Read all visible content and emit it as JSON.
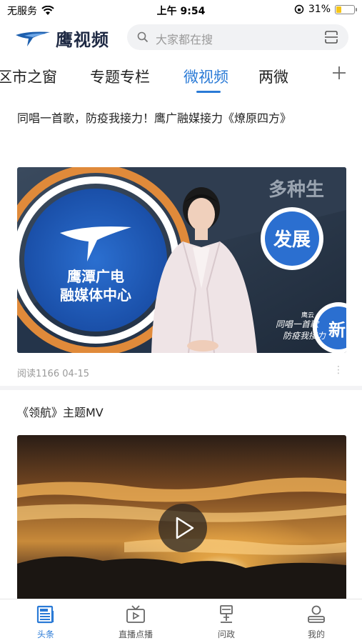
{
  "status_bar": {
    "carrier": "无服务",
    "time": "上午 9:54",
    "battery_percent": "31%",
    "battery_level": 0.31
  },
  "header": {
    "logo_text": "鹰视频",
    "search_placeholder": "大家都在搜"
  },
  "tabs": [
    {
      "label": "区市之窗",
      "active": false
    },
    {
      "label": "专题专栏",
      "active": false
    },
    {
      "label": "微视频",
      "active": true
    },
    {
      "label": "两微",
      "active": false
    }
  ],
  "feed": [
    {
      "title": "同唱一首歌，防疫我接力！鹰广融媒接力《燎原四方》",
      "meta": "阅读1166  04-15",
      "thumb_texts": {
        "center_line1": "鹰潭广电",
        "center_line2": "融媒体中心",
        "banner": "多种生",
        "badge": "发展",
        "caption_brand": "鹰云",
        "caption_line1": "同唱一首歌",
        "caption_line2": "防疫我接力",
        "side": "新"
      }
    },
    {
      "title": "《领航》主题MV"
    }
  ],
  "tabbar": [
    {
      "label": "头条",
      "icon": "headline-icon",
      "active": true
    },
    {
      "label": "直播点播",
      "icon": "tv-icon",
      "active": false
    },
    {
      "label": "问政",
      "icon": "podium-icon",
      "active": false
    },
    {
      "label": "我的",
      "icon": "user-icon",
      "active": false
    }
  ],
  "colors": {
    "accent": "#2a7ad6",
    "battery": "#f5c518"
  }
}
